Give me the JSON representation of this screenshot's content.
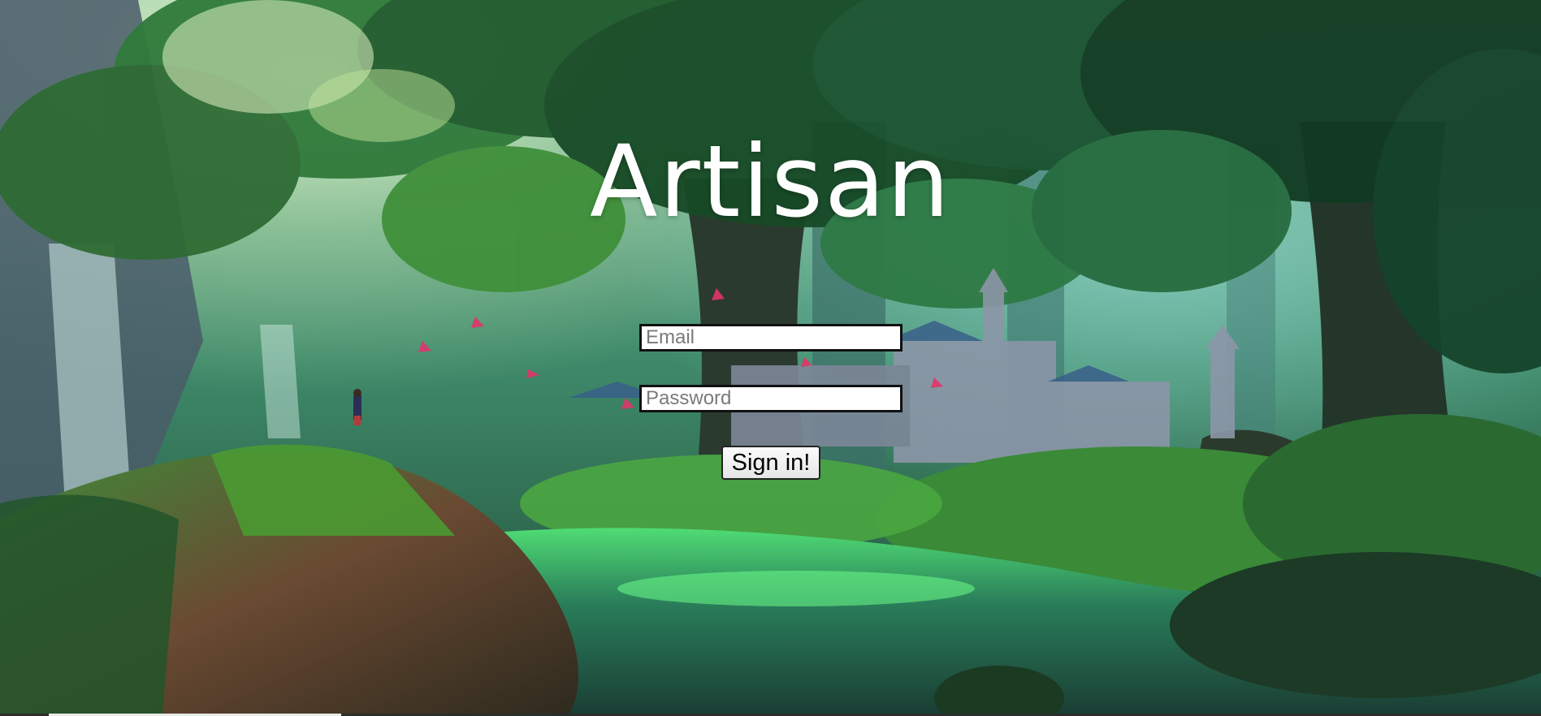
{
  "app": {
    "title": "Artisan"
  },
  "login": {
    "email_placeholder": "Email",
    "email_value": "",
    "password_placeholder": "Password",
    "password_value": "",
    "submit_label": "Sign in!"
  },
  "background": {
    "scene": "forest-illustration",
    "colors": {
      "canopy_dark": "#123a22",
      "canopy_mid": "#2f7a3b",
      "canopy_light": "#7fcf6a",
      "sky_glow": "#e8f5d0",
      "water": "#2aa06a",
      "rock": "#5a3a2a"
    }
  }
}
